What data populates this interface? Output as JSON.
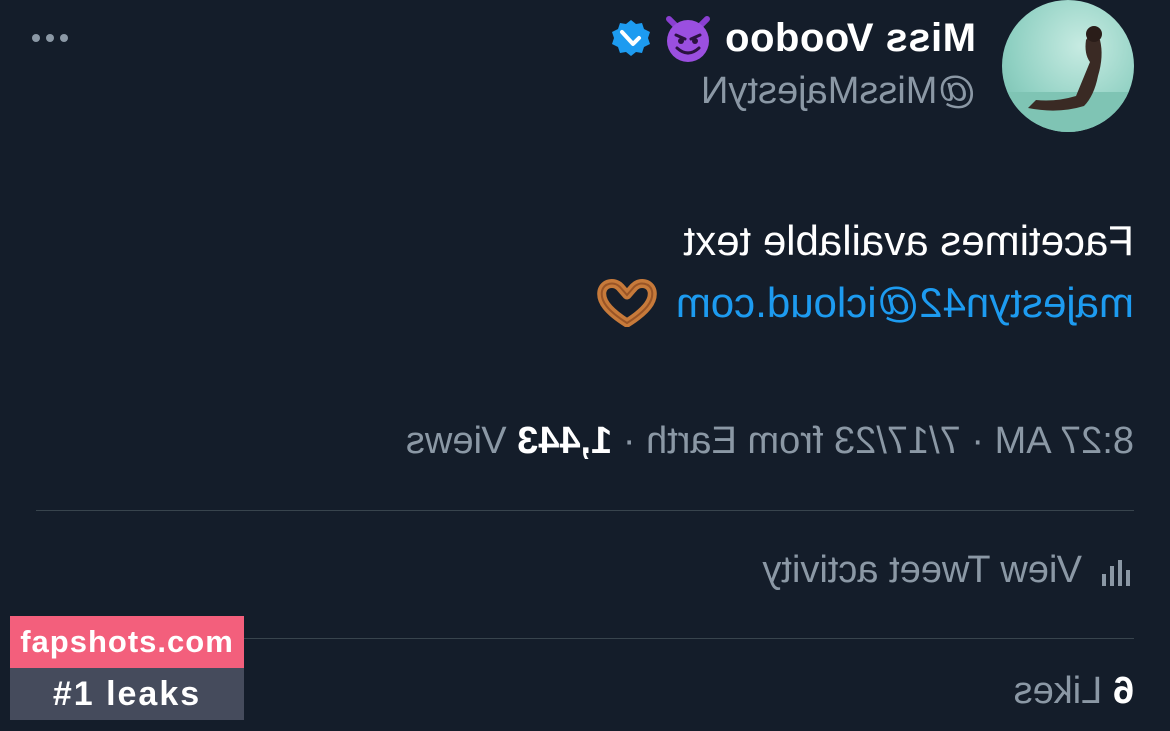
{
  "tweet": {
    "author_name": "Miss Voodoo",
    "author_handle": "@MissMajestyN",
    "text_line1": "Facetimes available text",
    "link_text": "majestyn42@icloud.com",
    "time": "8:27 AM",
    "date": "7/17/23",
    "source": "from Earth",
    "views_count": "1,443",
    "views_label": "Views",
    "activity_label": "View Tweet activity",
    "likes_count": "6",
    "likes_label": "Likes",
    "separator": "·"
  },
  "icons": [
    "more-icon",
    "verified-icon",
    "devil-emoji-icon",
    "heart-hands-emoji-icon",
    "activity-bars-icon"
  ],
  "watermark": {
    "site": "fapshots.com",
    "tagline": "#1 leaks"
  },
  "colors": {
    "background": "#141d2a",
    "link": "#1d9bf0",
    "muted": "#8b98a5",
    "divider": "#38444d",
    "watermark_pink": "#f35f7c",
    "watermark_gray": "#454b5c"
  }
}
